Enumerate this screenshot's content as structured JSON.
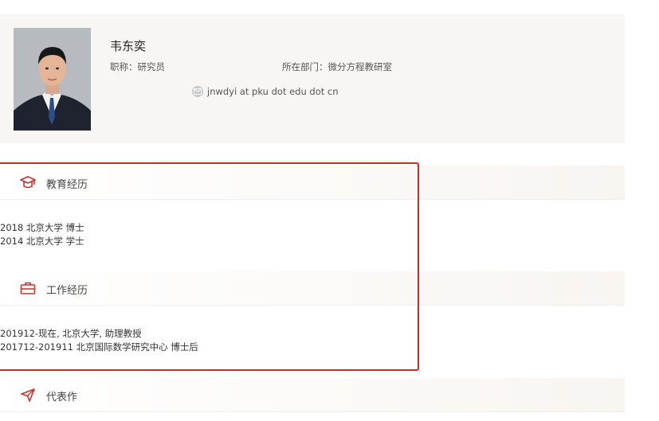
{
  "profile": {
    "name": "韦东奕",
    "title_label": "职称：",
    "title_value": "研究员",
    "dept_label": "所在部门：",
    "dept_value": "微分方程教研室",
    "email": "jnwdyi at pku dot edu dot cn",
    "email_icon": "email-icon"
  },
  "education": {
    "title": "教育经历",
    "icon": "graduation-cap-icon",
    "entries": [
      "2018 北京大学 博士",
      "2014 北京大学 学士"
    ]
  },
  "work": {
    "title": "工作经历",
    "icon": "briefcase-icon",
    "entries": [
      "201912-现在, 北京大学, 助理教授",
      "201712-201911 北京国际数学研究中心 博士后"
    ]
  },
  "works": {
    "title": "代表作",
    "icon": "send-icon"
  },
  "colors": {
    "accent": "#c9302c",
    "highlight": "#d9261c",
    "card_bg": "#f7f6f4"
  }
}
